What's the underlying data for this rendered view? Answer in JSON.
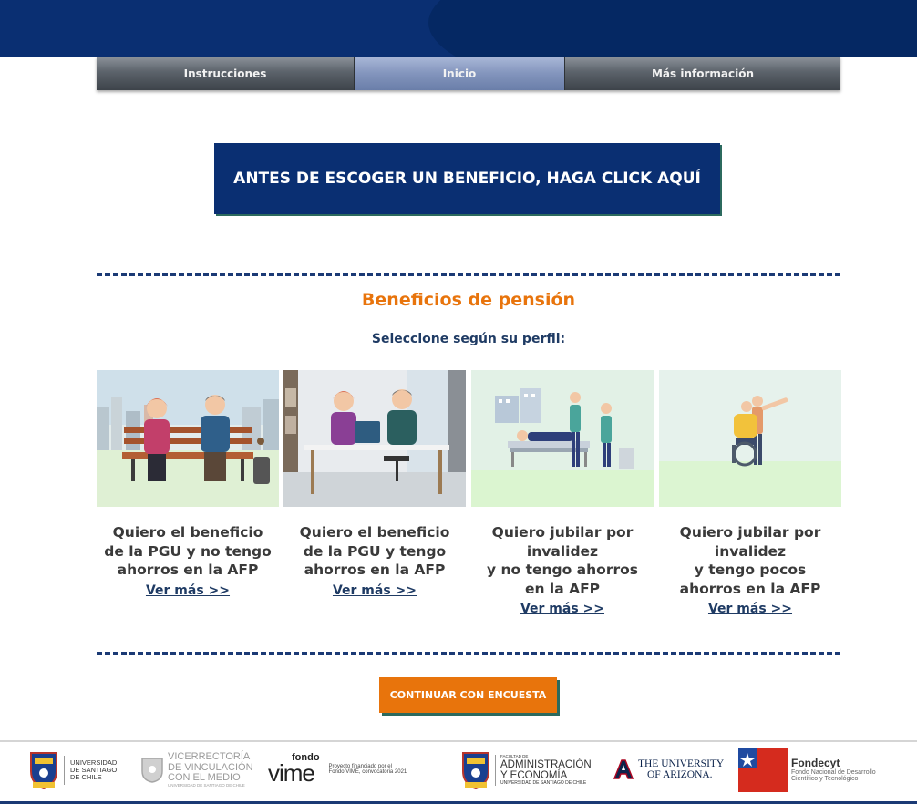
{
  "nav": {
    "items": [
      {
        "label": "Instrucciones"
      },
      {
        "label": "Inicio"
      },
      {
        "label": "Más información"
      }
    ],
    "active_index": 1
  },
  "banner": {
    "label": "ANTES DE ESCOGER UN BENEFICIO, HAGA CLICK AQUÍ"
  },
  "section": {
    "title": "Beneficios de pensión",
    "subtitle": "Seleccione según su perfil:"
  },
  "cards": [
    {
      "text": "Quiero el beneficio\nde la PGU y no tengo\nahorros en la AFP",
      "link": "Ver más >>",
      "illustration": "couple-on-bench-illustration"
    },
    {
      "text": "Quiero el beneficio\nde la PGU y tengo\nahorros en la AFP",
      "link": "Ver más >>",
      "illustration": "couple-at-laptop-illustration"
    },
    {
      "text": "Quiero jubilar por\ninvalidez\ny no tengo ahorros\nen la AFP",
      "link": "Ver más >>",
      "illustration": "hospital-bed-illustration"
    },
    {
      "text": "Quiero jubilar por\ninvalidez\ny tengo pocos\nahorros en la AFP",
      "link": "Ver más >>",
      "illustration": "wheelchair-illustration"
    }
  ],
  "continue_button": {
    "label": "CONTINUAR CON ENCUESTA"
  },
  "footer": {
    "usach": {
      "line1": "UNIVERSIDAD",
      "line2": "DE SANTIAGO",
      "line3": "DE CHILE"
    },
    "vime_office": {
      "line1": "VICERRECTORÍA",
      "line2": "DE VINCULACIÓN",
      "line3": "CON EL MEDIO",
      "line4": "UNIVERSIDAD DE SANTIAGO DE CHILE"
    },
    "fondo_vime": {
      "line1": "fondo",
      "line2": "vime",
      "note1": "Proyecto financiado por el",
      "note2": "Fondo VIME, convocatoria 2021"
    },
    "faculty": {
      "line0": "FACULTAD DE",
      "line1": "ADMINISTRACIÓN",
      "line2": "Y ECONOMÍA",
      "line3": "UNIVERSIDAD DE SANTIAGO DE CHILE"
    },
    "arizona": {
      "line1": "THE UNIVERSITY",
      "line2": "OF ARIZONA."
    },
    "fondecyt": {
      "title": "Fondecyt",
      "line1": "Fondo Nacional de Desarrollo",
      "line2": "Científico y Tecnológico"
    }
  },
  "colors": {
    "brand_navy": "#0a2f72",
    "accent_orange": "#e8740c",
    "shadow_green": "#2c6a5e"
  }
}
